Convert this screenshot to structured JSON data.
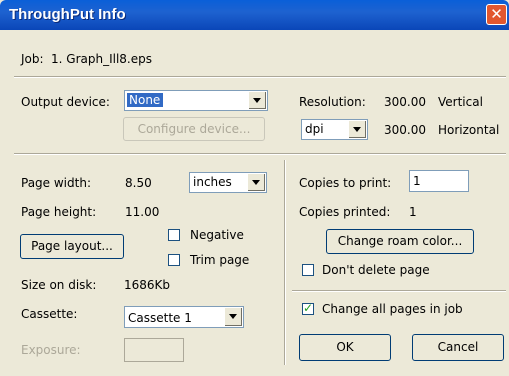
{
  "window": {
    "title": "ThroughPut Info",
    "close_glyph": "✕"
  },
  "job": {
    "label": "Job:",
    "value": "1. Graph_Ill8.eps"
  },
  "output": {
    "device_label": "Output device:",
    "device_value": "None",
    "configure_label": "Configure device...",
    "resolution_label": "Resolution:",
    "res_vertical_value": "300.00",
    "res_vertical_label": "Vertical",
    "res_unit": "dpi",
    "res_horizontal_value": "300.00",
    "res_horizontal_label": "Horizontal"
  },
  "page": {
    "width_label": "Page width:",
    "width_value": "8.50",
    "units": "inches",
    "height_label": "Page height:",
    "height_value": "11.00",
    "layout_label": "Page layout...",
    "negative_label": "Negative",
    "trim_label": "Trim page",
    "size_label": "Size on disk:",
    "size_value": "1686Kb",
    "cassette_label": "Cassette:",
    "cassette_value": "Cassette 1",
    "exposure_label": "Exposure:",
    "exposure_value": ""
  },
  "copies": {
    "to_print_label": "Copies to print:",
    "to_print_value": "1",
    "printed_label": "Copies printed:",
    "printed_value": "1",
    "roam_label": "Change roam color...",
    "dont_delete_label": "Don't delete page",
    "change_all_label": "Change all pages in job"
  },
  "buttons": {
    "ok": "OK",
    "cancel": "Cancel"
  },
  "state": {
    "negative_checked": false,
    "trim_checked": false,
    "dont_delete_checked": false,
    "change_all_checked": true
  },
  "colors": {
    "titlebar": "#0a5fd8",
    "dialog_bg": "#ece9d8",
    "selection": "#316ac5",
    "close_button": "#e2572f"
  },
  "icons": {
    "close": "close-icon",
    "dropdown": "chevron-down-icon",
    "check": "checkmark-icon"
  }
}
